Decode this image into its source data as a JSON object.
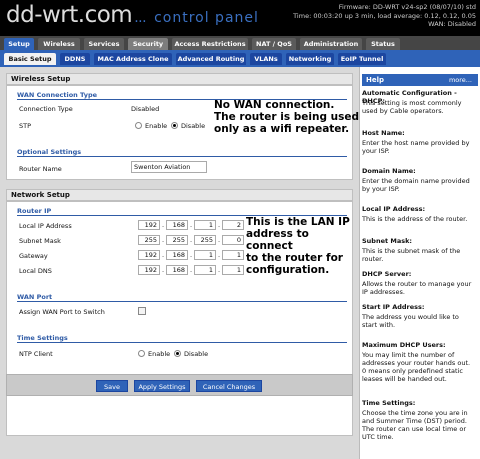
{
  "header": {
    "logo": "dd-wrt.com",
    "dots": "...",
    "subtitle": "control panel",
    "firmware": "Firmware: DD-WRT v24-sp2 (08/07/10) std",
    "time": "Time: 00:03:20 up 3 min, load average: 0.12, 0.12, 0.05",
    "wan": "WAN: Disabled"
  },
  "tabs": [
    "Setup",
    "Wireless",
    "Services",
    "Security",
    "Access Restrictions",
    "NAT / QoS",
    "Administration",
    "Status"
  ],
  "subtabs": [
    "Basic Setup",
    "DDNS",
    "MAC Address Clone",
    "Advanced Routing",
    "VLANs",
    "Networking",
    "EoIP Tunnel"
  ],
  "wireless_setup": {
    "title": "Wireless Setup",
    "wan_legend": "WAN Connection Type",
    "conn_label": "Connection Type",
    "conn_value": "Disabled",
    "stp_label": "STP",
    "enable": "Enable",
    "disable": "Disable",
    "opt_legend": "Optional Settings",
    "router_name_label": "Router Name",
    "router_name": "Swenton Aviation"
  },
  "network_setup": {
    "title": "Network Setup",
    "router_ip_legend": "Router IP",
    "local_ip_label": "Local IP Address",
    "local_ip": [
      "192",
      "168",
      "1",
      "2"
    ],
    "subnet_label": "Subnet Mask",
    "subnet": [
      "255",
      "255",
      "255",
      "0"
    ],
    "gateway_label": "Gateway",
    "gateway": [
      "192",
      "168",
      "1",
      "1"
    ],
    "dns_label": "Local DNS",
    "dns": [
      "192",
      "168",
      "1",
      "1"
    ],
    "wan_port_legend": "WAN Port",
    "assign_label": "Assign WAN Port to Switch",
    "time_legend": "Time Settings",
    "ntp_label": "NTP Client",
    "enable": "Enable",
    "disable": "Disable"
  },
  "notes": {
    "wan": [
      "No WAN connection.",
      "The router is being used",
      "only as a wifi repeater."
    ],
    "lan": [
      "This is the LAN IP",
      "address to connect",
      "to the router for",
      "configuration."
    ]
  },
  "buttons": {
    "save": "Save",
    "apply": "Apply Settings",
    "cancel": "Cancel Changes"
  },
  "help": {
    "title": "Help",
    "more": "more...",
    "items": [
      {
        "t": "Automatic Configuration - DHCP:",
        "b": "This setting is most commonly used by Cable operators."
      },
      {
        "t": "Host Name:",
        "b": "Enter the host name provided by your ISP."
      },
      {
        "t": "Domain Name:",
        "b": "Enter the domain name provided by your ISP."
      },
      {
        "t": "Local IP Address:",
        "b": "This is the address of the router."
      },
      {
        "t": "Subnet Mask:",
        "b": "This is the subnet mask of the router."
      },
      {
        "t": "DHCP Server:",
        "b": "Allows the router to manage your IP addresses."
      },
      {
        "t": "Start IP Address:",
        "b": "The address you would like to start with."
      },
      {
        "t": "Maximum DHCP Users:",
        "b": "You may limit the number of addresses your router hands out. 0 means only predefined static leases will be handed out."
      },
      {
        "t": "Time Settings:",
        "b": "Choose the time zone you are in and Summer Time (DST) period. The router can use local time or UTC time."
      }
    ]
  }
}
